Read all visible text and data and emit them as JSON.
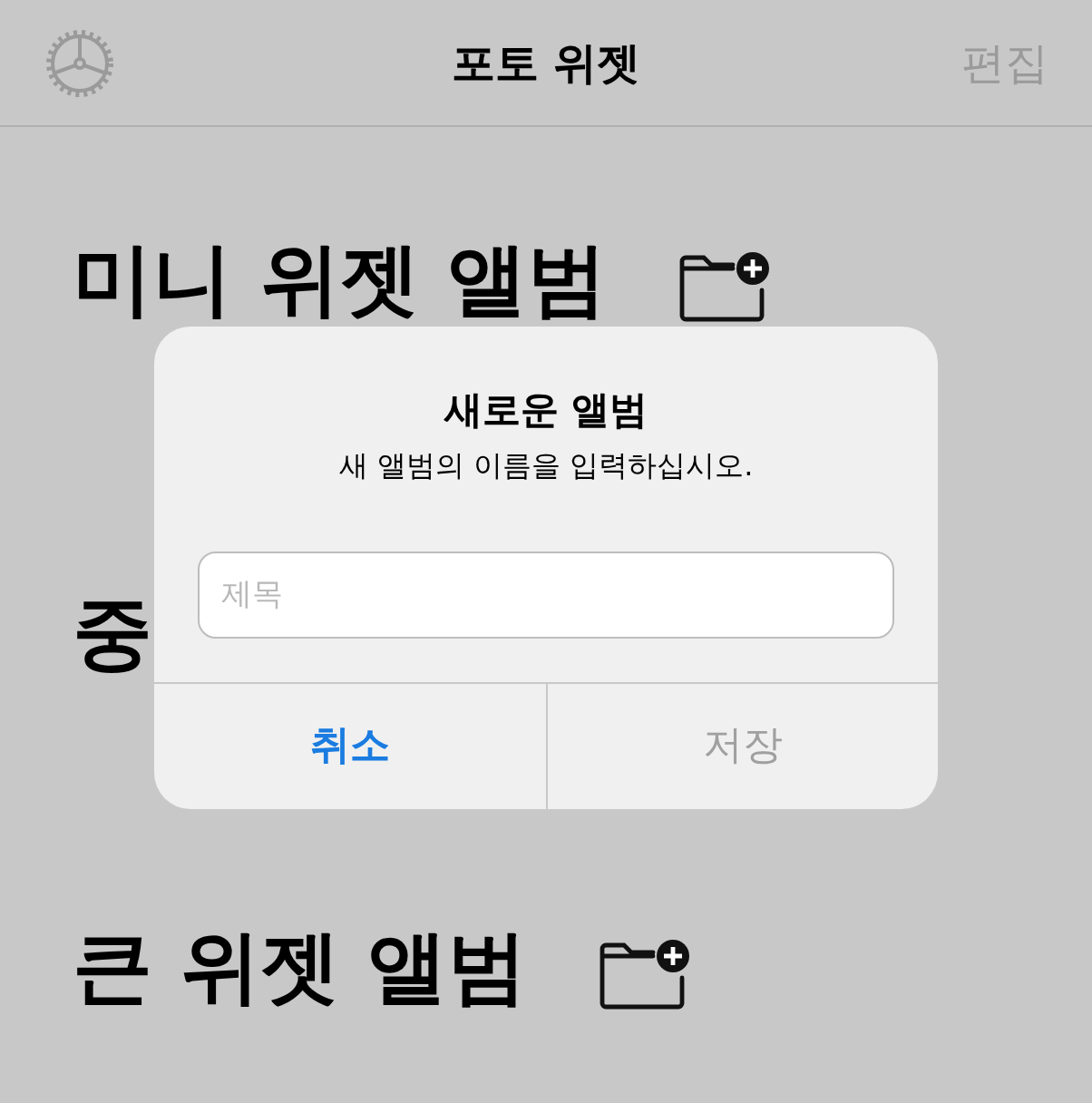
{
  "nav_bar": {
    "title": "포토 위젯",
    "edit_button": {
      "label": "편집",
      "disabled": true
    }
  },
  "sections": [
    {
      "title": "미니 위젯 앨범",
      "add_icon": true
    },
    {
      "title": "중",
      "add_icon": false
    },
    {
      "title": "큰 위젯 앨범",
      "add_icon": true
    }
  ],
  "dialog": {
    "title": "새로운 앨범",
    "message": "새 앨범의 이름을 입력하십시오.",
    "field": {
      "placeholder": "제목"
    },
    "buttons": [
      {
        "label": "취소",
        "disabled": false
      },
      {
        "label": "저장",
        "disabled": true
      }
    ]
  }
}
